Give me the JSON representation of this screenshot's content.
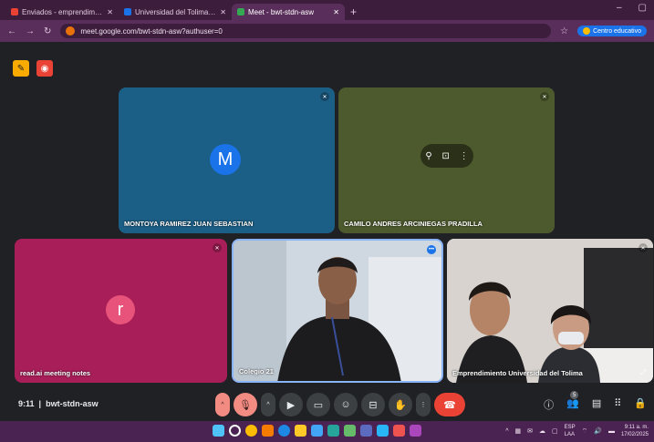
{
  "browser": {
    "tabs": [
      {
        "label": "Enviados - emprendimiento@u",
        "color": "#ea4335"
      },
      {
        "label": "Universidad del Tolima - Calen",
        "color": "#1a73e8"
      },
      {
        "label": "Meet - bwt-stdn-asw",
        "color": "#34a853"
      }
    ],
    "url": "meet.google.com/bwt-stdn-asw?authuser=0",
    "profile_label": "Centro educativo"
  },
  "meet": {
    "participants": [
      {
        "name": "MONTOYA RAMIREZ JUAN SEBASTIAN",
        "initial": "M",
        "avatar_color": "#1a73e8"
      },
      {
        "name": "CAMILO ANDRES ARCINIEGAS PRADILLA"
      },
      {
        "name": "read.ai meeting notes",
        "initial": "r",
        "avatar_color": "#e8537b"
      },
      {
        "name": "Colegio 21"
      },
      {
        "name": "Emprendimiento Universidad del Tolima"
      }
    ],
    "time": "9:11",
    "meeting_code": "bwt-stdn-asw",
    "participant_count": "5"
  },
  "taskbar": {
    "lang_1": "ESP",
    "lang_2": "LAA",
    "clock_time": "9:11 a. m.",
    "clock_date": "17/02/2025"
  }
}
